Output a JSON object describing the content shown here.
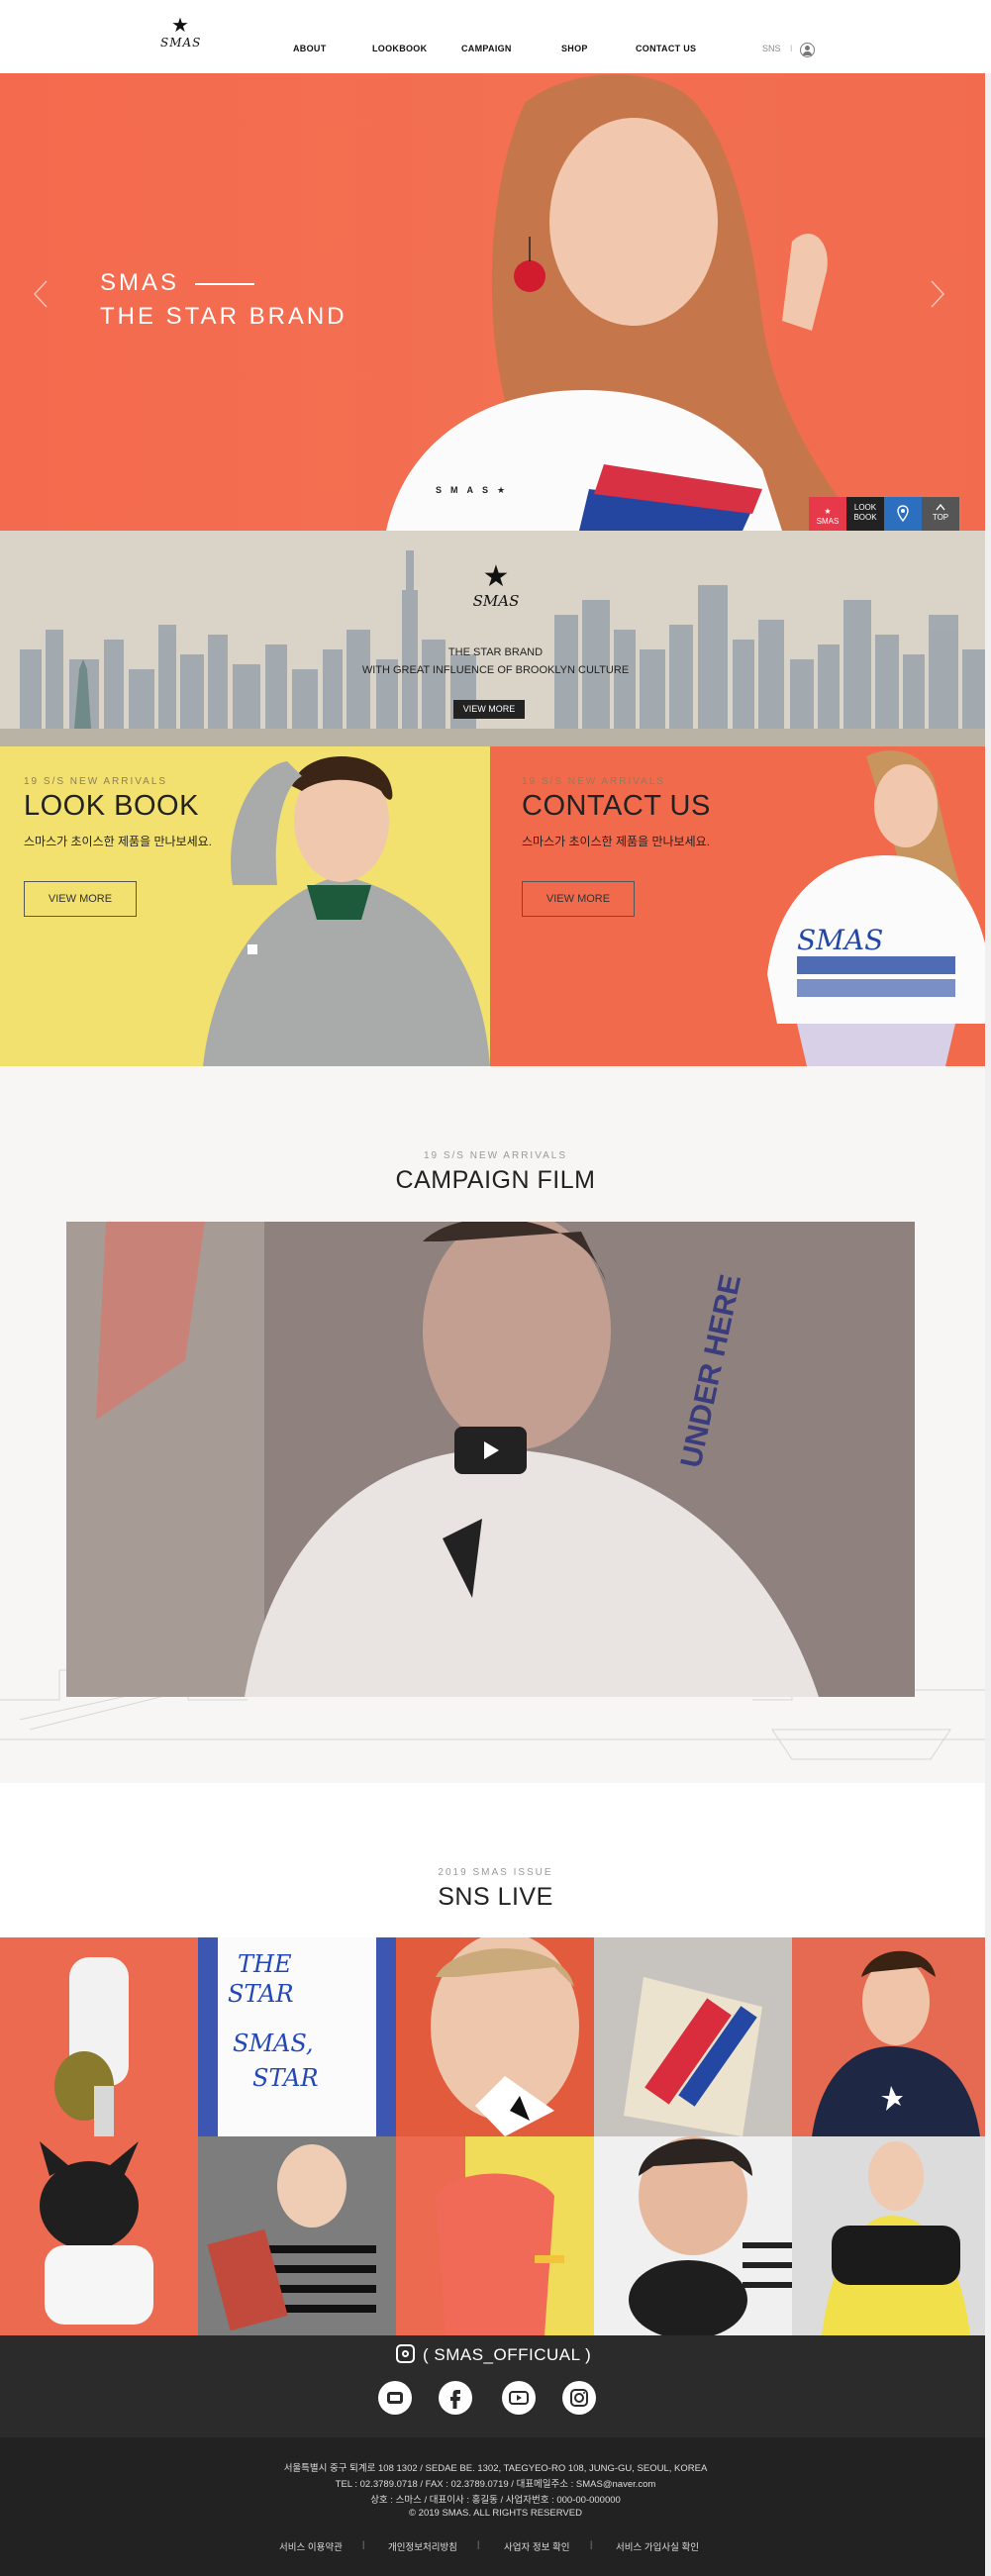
{
  "header": {
    "logo_text": "SMAS",
    "nav": [
      "ABOUT",
      "LOOKBOOK",
      "CAMPAIGN",
      "SHOP",
      "CONTACT US"
    ],
    "sns_label": "SNS",
    "sep": "I"
  },
  "hero": {
    "title_line1": "SMAS",
    "title_line2": "THE STAR BRAND",
    "brand_strip": "SMAS★",
    "quick_menu": [
      {
        "label1": "SMAS",
        "label2": ""
      },
      {
        "label1": "LOOK",
        "label2": "BOOK"
      },
      {
        "label1": "",
        "label2": ""
      },
      {
        "label1": "TOP",
        "label2": ""
      }
    ],
    "colors": {
      "accent": "#f46a4e",
      "quick1": "#e63a4b",
      "quick2": "#222222",
      "quick3": "#2c6fbf",
      "quick4": "#555555"
    }
  },
  "city": {
    "logo_text": "SMAS",
    "line1": "THE STAR BRAND",
    "line2": "WITH GREAT INFLUENCE OF BROOKLYN CULTURE",
    "button": "VIEW MORE"
  },
  "lookbook": {
    "sub": "19 S/S NEW ARRIVALS",
    "title": "LOOK BOOK",
    "desc": "스마스가 초이스한 제품을 만나보세요.",
    "button": "VIEW MORE",
    "color": "#f2e16e"
  },
  "contact": {
    "sub": "19 S/S NEW ARRIVALS",
    "title": "CONTACT US",
    "desc": "스마스가 초이스한 제품을 만나보세요.",
    "button": "VIEW MORE",
    "color": "#f26a4c"
  },
  "campaign": {
    "sub": "19 S/S NEW ARRIVALS",
    "title": "CAMPAIGN FILM"
  },
  "sns": {
    "sub": "2019 SMAS ISSUE",
    "title": "SNS LIVE",
    "handle": "( SMAS_OFFICUAL )"
  },
  "footer": {
    "address": "서울특별시 중구 퇴계로 108 1302  /  SEDAE BE. 1302, TAEGYEO-RO 108, JUNG-GU, SEOUL, KOREA",
    "contact": "TEL : 02.3789.0718  /  FAX : 02.3789.0719  /  대표메일주소 : SMAS@naver.com",
    "company": "상호 : 스마스  /  대표이사 : 홍길동  /  사업자번호 : 000-00-000000",
    "copyright": "© 2019 SMAS. ALL RIGHTS RESERVED",
    "links": [
      "서비스 이용약관",
      "개인정보처리방침",
      "사업자 정보 확인",
      "서비스 가입사실 확인"
    ]
  }
}
